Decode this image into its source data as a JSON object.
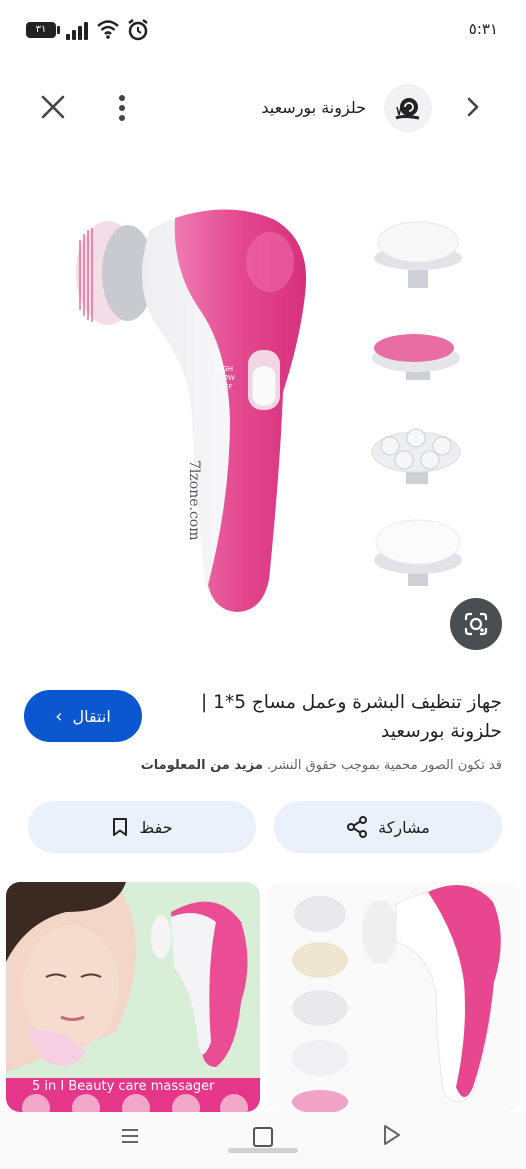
{
  "status_bar": {
    "time": "٥:٣١",
    "battery": "٣١"
  },
  "header": {
    "title": "حلزونة بورسعيد",
    "icons": [
      "close-icon",
      "more-vert-icon",
      "site-logo",
      "chevron-right-icon"
    ]
  },
  "image": {
    "watermark": "7lzone.com",
    "switch_labels": [
      "HIGH",
      "LOW",
      "OFF"
    ]
  },
  "product": {
    "title": "جهاز تنظيف البشرة وعمل مساج 5*1 | حلزونة بورسعيد",
    "visit_label": "انتقال",
    "notice_text": "قد تكون الصور محمية بموجب حقوق النشر.",
    "notice_link": "مزيد من المعلومات",
    "share_label": "مشاركة",
    "save_label": "حفظ"
  },
  "related": [
    {
      "caption": "5 in I Beauty care massager"
    },
    {
      "caption": ""
    }
  ],
  "colors": {
    "accent": "#0b57d0",
    "pill_bg": "#eaf1fb",
    "device_pink": "#e8559a"
  }
}
